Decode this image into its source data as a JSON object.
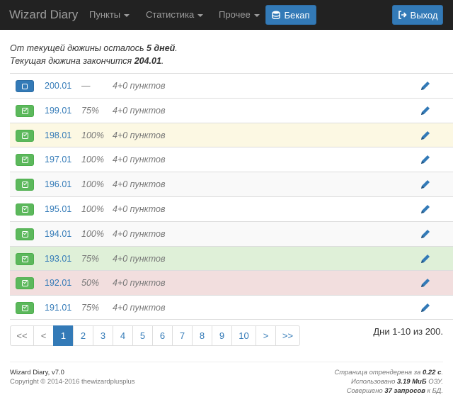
{
  "navbar": {
    "brand": "Wizard Diary",
    "menu": [
      {
        "label": "Пункты"
      },
      {
        "label": "Статистика"
      },
      {
        "label": "Прочее"
      }
    ],
    "backup_label": "Бекап",
    "logout_label": "Выход"
  },
  "info": {
    "line1_prefix": "От текущей дюжины осталось ",
    "line1_value": "5 дней",
    "line1_suffix": ".",
    "line2_prefix": "Текущая дюжина закончится ",
    "line2_value": "204.01",
    "line2_suffix": "."
  },
  "days": [
    {
      "date": "200.01",
      "percent": "—",
      "points": "4+0 пунктов",
      "status": "current",
      "row_style": "plain"
    },
    {
      "date": "199.01",
      "percent": "75%",
      "points": "4+0 пунктов",
      "status": "done",
      "row_style": "plain"
    },
    {
      "date": "198.01",
      "percent": "100%",
      "points": "4+0 пунктов",
      "status": "done",
      "row_style": "warning"
    },
    {
      "date": "197.01",
      "percent": "100%",
      "points": "4+0 пунктов",
      "status": "done",
      "row_style": "plain"
    },
    {
      "date": "196.01",
      "percent": "100%",
      "points": "4+0 пунктов",
      "status": "done",
      "row_style": "stripe"
    },
    {
      "date": "195.01",
      "percent": "100%",
      "points": "4+0 пунктов",
      "status": "done",
      "row_style": "plain"
    },
    {
      "date": "194.01",
      "percent": "100%",
      "points": "4+0 пунктов",
      "status": "done",
      "row_style": "stripe"
    },
    {
      "date": "193.01",
      "percent": "75%",
      "points": "4+0 пунктов",
      "status": "done",
      "row_style": "success"
    },
    {
      "date": "192.01",
      "percent": "50%",
      "points": "4+0 пунктов",
      "status": "done",
      "row_style": "danger"
    },
    {
      "date": "191.01",
      "percent": "75%",
      "points": "4+0 пунктов",
      "status": "done",
      "row_style": "plain"
    }
  ],
  "pagination": {
    "first": "<<",
    "prev": "<",
    "pages": [
      "1",
      "2",
      "3",
      "4",
      "5",
      "6",
      "7",
      "8",
      "9",
      "10"
    ],
    "active_page": "1",
    "next": ">",
    "last": ">>"
  },
  "days_summary": "Дни 1-10 из 200.",
  "footer": {
    "app_name": "Wizard Diary, v7.0",
    "copyright": "Copyright © 2014-2016 thewizardplusplus",
    "render_prefix": "Страница отрендерена за ",
    "render_value": "0.22 с",
    "render_suffix": ".",
    "memory_prefix": "Использовано ",
    "memory_value": "3.19 МиБ",
    "memory_suffix": " ОЗУ.",
    "queries_prefix": "Совершено ",
    "queries_value": "37 запросов",
    "queries_suffix": " к БД."
  },
  "colors": {
    "navbar_bg": "#222222",
    "primary": "#337ab7",
    "success_button": "#5cb85c",
    "row_warning": "#fcf8e3",
    "row_success": "#dff0d8",
    "row_danger": "#f2dede"
  },
  "icons": {
    "backup": "database-icon",
    "logout": "sign-out-icon",
    "edit": "pencil-icon",
    "done": "check-square-icon",
    "current": "stop-icon"
  }
}
